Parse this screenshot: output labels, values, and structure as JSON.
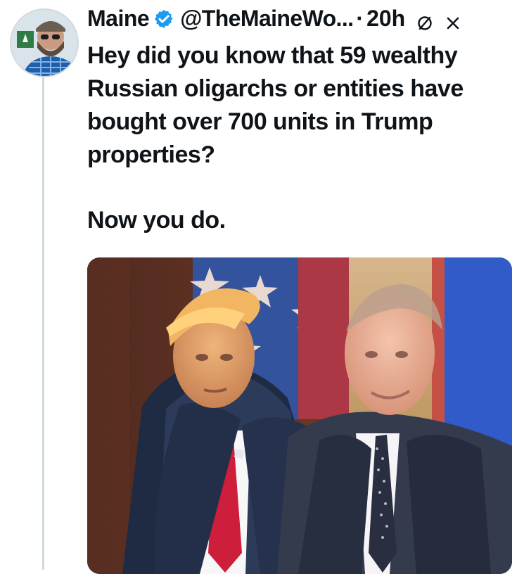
{
  "tweet": {
    "author": {
      "display_name": "Maine",
      "handle": "@TheMaineWo...",
      "verified": true,
      "avatar_icon": "user-avatar-icon"
    },
    "separator": "·",
    "time": "20h",
    "text": [
      "Hey did you know that 59 wealthy Russian oligarchs or entities have bought over 700 units in Trump properties?",
      "Now you do."
    ],
    "icons": [
      "grok-icon",
      "close-icon"
    ],
    "colors": {
      "text": "#0f1419",
      "verified": "#1d9bf0",
      "thread_line": "#cfd9de"
    }
  }
}
